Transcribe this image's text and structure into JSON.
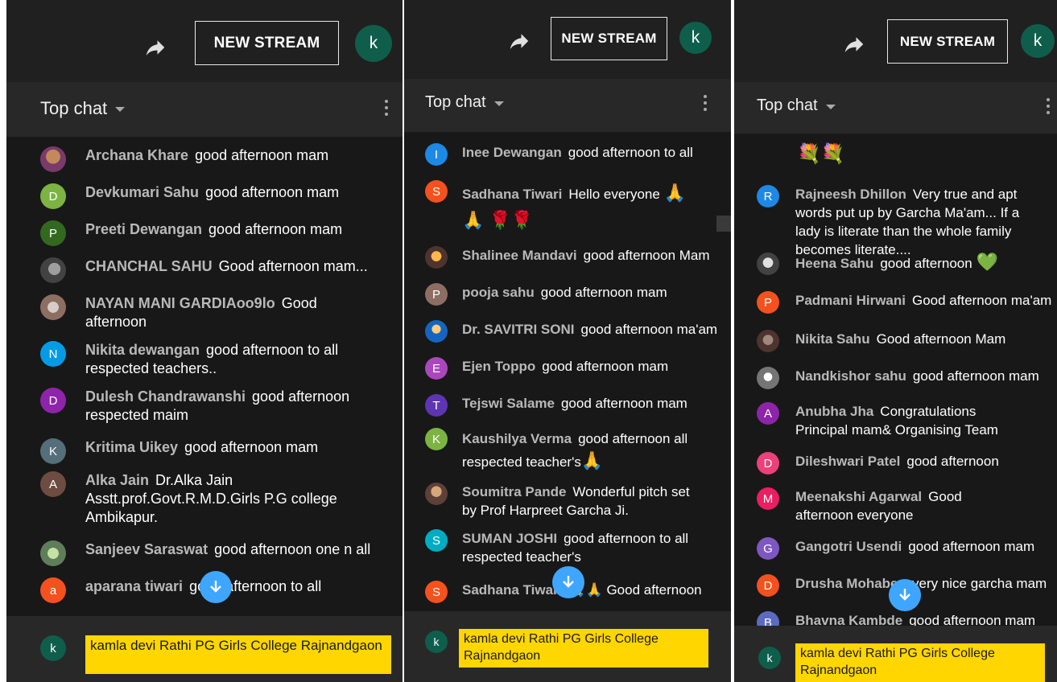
{
  "colors": {
    "accent": "#3ea6ff",
    "highlight": "#ffd600",
    "panel_bg": "#181818",
    "header_bg": "#282828"
  },
  "icons": {
    "share": "share-arrow-icon",
    "menu": "more-vert-icon",
    "scroll_down": "arrow-down-icon",
    "dropdown": "caret-down-icon"
  },
  "panels": [
    {
      "new_stream_label": "NEW STREAM",
      "account_initial": "k",
      "chat_mode": "Top chat",
      "messages": [
        {
          "initial": "",
          "author": "Archana Khare",
          "text": "good afternoon mam"
        },
        {
          "initial": "D",
          "author": "Devkumari Sahu",
          "text": "good afternoon mam"
        },
        {
          "initial": "P",
          "author": "Preeti Dewangan",
          "text": "good afternoon mam"
        },
        {
          "initial": "",
          "author": "CHANCHAL SAHU",
          "text": "Good afternoon mam..."
        },
        {
          "initial": "",
          "author": "NAYAN MANI GARDIAoo9lo",
          "text": "Good afternoon"
        },
        {
          "initial": "N",
          "author": "Nikita dewangan",
          "text": "good afternoon to all respected teachers.."
        },
        {
          "initial": "D",
          "author": "Dulesh Chandrawanshi",
          "text": "good afternoon respected maim"
        },
        {
          "initial": "K",
          "author": "Kritima Uikey",
          "text": "good afternoon mam"
        },
        {
          "initial": "A",
          "author": "Alka Jain",
          "text": "Dr.Alka Jain Asstt.prof.Govt.R.M.D.Girls P.G college Ambikapur."
        },
        {
          "initial": "",
          "author": "Sanjeev Saraswat",
          "text": "good afternoon one n all"
        },
        {
          "initial": "a",
          "author": "aparana tiwari",
          "text": "good afternoon to all"
        }
      ],
      "footer_initial": "k",
      "footer_channel": "kamla devi Rathi PG Girls College Rajnandgaon"
    },
    {
      "new_stream_label": "NEW STREAM",
      "account_initial": "k",
      "chat_mode": "Top chat",
      "messages": [
        {
          "initial": "I",
          "author": "Inee Dewangan",
          "text": "good afternoon to all"
        },
        {
          "initial": "S",
          "author": "Sadhana Tiwari",
          "text": "Hello everyone",
          "emoji": "🙏🙏 🌹🌹"
        },
        {
          "initial": "",
          "author": "Shalinee Mandavi",
          "text": "good afternoon Mam"
        },
        {
          "initial": "P",
          "author": "pooja sahu",
          "text": "good afternoon mam"
        },
        {
          "initial": "",
          "author": "Dr. SAVITRI SONI",
          "text": "good afternoon ma'am"
        },
        {
          "initial": "E",
          "author": "Ejen Toppo",
          "text": "good afternoon mam"
        },
        {
          "initial": "T",
          "author": "Tejswi Salame",
          "text": "good afternoon mam"
        },
        {
          "initial": "K",
          "author": "Kaushilya Verma",
          "text": "good afternoon all respected teacher's",
          "emoji": "🙏"
        },
        {
          "initial": "",
          "author": "Soumitra Pande",
          "text": "Wonderful pitch set by Prof Harpreet Garcha Ji."
        },
        {
          "initial": "S",
          "author": "SUMAN JOSHI",
          "text": "good afternoon to all respected teacher's"
        },
        {
          "initial": "S",
          "author": "Sadhana Tiwari",
          "text": "🙏🙏 Good afternoon"
        }
      ],
      "footer_initial": "k",
      "footer_channel": "kamla devi Rathi PG Girls College Rajnandgaon"
    },
    {
      "new_stream_label": "NEW STREAM",
      "account_initial": "k",
      "chat_mode": "Top chat",
      "messages": [
        {
          "initial": "",
          "author": "",
          "text": "💐💐"
        },
        {
          "initial": "R",
          "author": "Rajneesh Dhillon",
          "text": "Very true and apt words put up by Garcha Ma'am... If a lady is literate than the whole family becomes literate...."
        },
        {
          "initial": "",
          "author": "Heena Sahu",
          "text": "good afternoon",
          "emoji": "💚"
        },
        {
          "initial": "P",
          "author": "Padmani Hirwani",
          "text": "Good afternoon ma'am"
        },
        {
          "initial": "",
          "author": "Nikita Sahu",
          "text": "Good afternoon Mam"
        },
        {
          "initial": "",
          "author": "Nandkishor sahu",
          "text": "good afternoon mam"
        },
        {
          "initial": "A",
          "author": "Anubha Jha",
          "text": "Congratulations Principal mam& Organising Team"
        },
        {
          "initial": "D",
          "author": "Dileshwari Patel",
          "text": "good afternoon"
        },
        {
          "initial": "M",
          "author": "Meenakshi Agarwal",
          "text": "Good afternoon everyone"
        },
        {
          "initial": "G",
          "author": "Gangotri Usendi",
          "text": "good afternoon mam"
        },
        {
          "initial": "D",
          "author": "Drusha Mohabey",
          "text": "very nice garcha mam"
        },
        {
          "initial": "B",
          "author": "Bhavna Kambde",
          "text": "good afternoon mam"
        }
      ],
      "footer_initial": "k",
      "footer_channel": "kamla devi Rathi PG Girls College Rajnandgaon"
    }
  ]
}
